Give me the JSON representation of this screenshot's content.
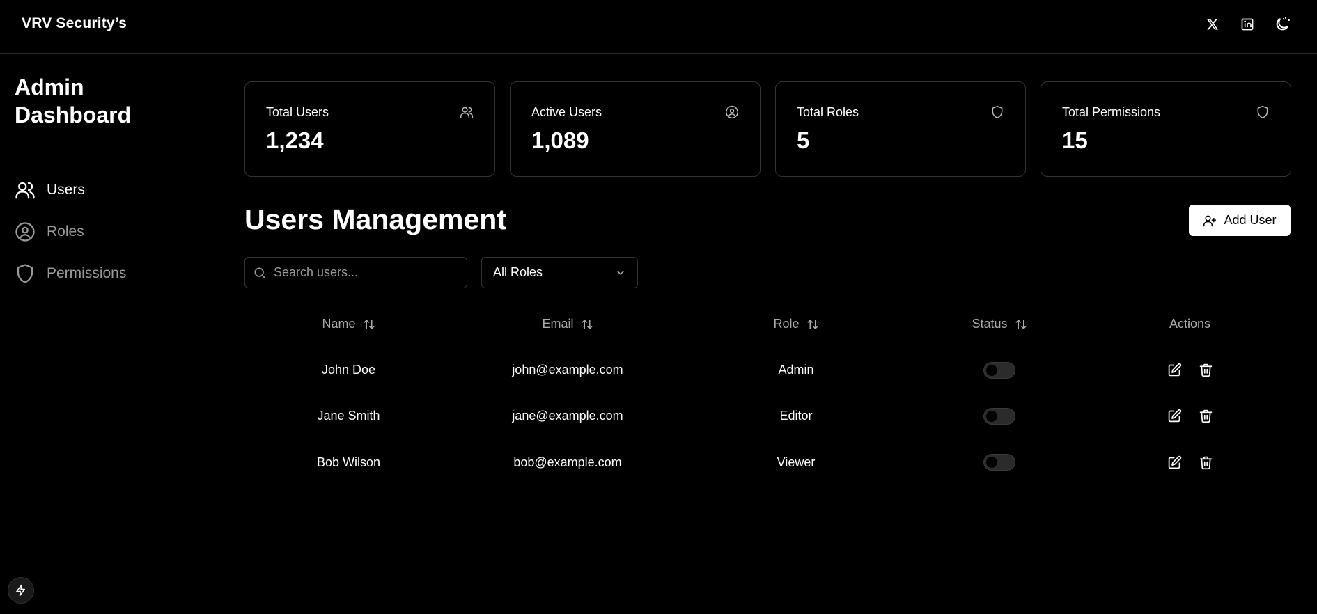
{
  "header": {
    "brand": "VRV Security’s",
    "icons": [
      "x-icon",
      "linkedin-icon",
      "theme-toggle-icon"
    ]
  },
  "sidebar": {
    "title": "Admin Dashboard",
    "items": [
      {
        "label": "Users",
        "icon": "users-icon",
        "active": true
      },
      {
        "label": "Roles",
        "icon": "user-circle-icon",
        "active": false
      },
      {
        "label": "Permissions",
        "icon": "shield-icon",
        "active": false
      }
    ]
  },
  "stats": [
    {
      "label": "Total Users",
      "value": "1,234",
      "icon": "users-icon"
    },
    {
      "label": "Active Users",
      "value": "1,089",
      "icon": "user-circle-icon"
    },
    {
      "label": "Total Roles",
      "value": "5",
      "icon": "shield-icon"
    },
    {
      "label": "Total Permissions",
      "value": "15",
      "icon": "shield-icon"
    }
  ],
  "main": {
    "title": "Users Management",
    "add_label": "Add User",
    "search_placeholder": "Search users...",
    "role_filter": "All Roles"
  },
  "table": {
    "headers": {
      "name": "Name",
      "email": "Email",
      "role": "Role",
      "status": "Status",
      "actions": "Actions"
    },
    "rows": [
      {
        "name": "John Doe",
        "email": "john@example.com",
        "role": "Admin",
        "active": false
      },
      {
        "name": "Jane Smith",
        "email": "jane@example.com",
        "role": "Editor",
        "active": false
      },
      {
        "name": "Bob Wilson",
        "email": "bob@example.com",
        "role": "Viewer",
        "active": false
      }
    ]
  },
  "colors": {
    "background": "#000000",
    "text": "#ffffff",
    "muted": "#9a9a9a",
    "border": "#333333"
  }
}
